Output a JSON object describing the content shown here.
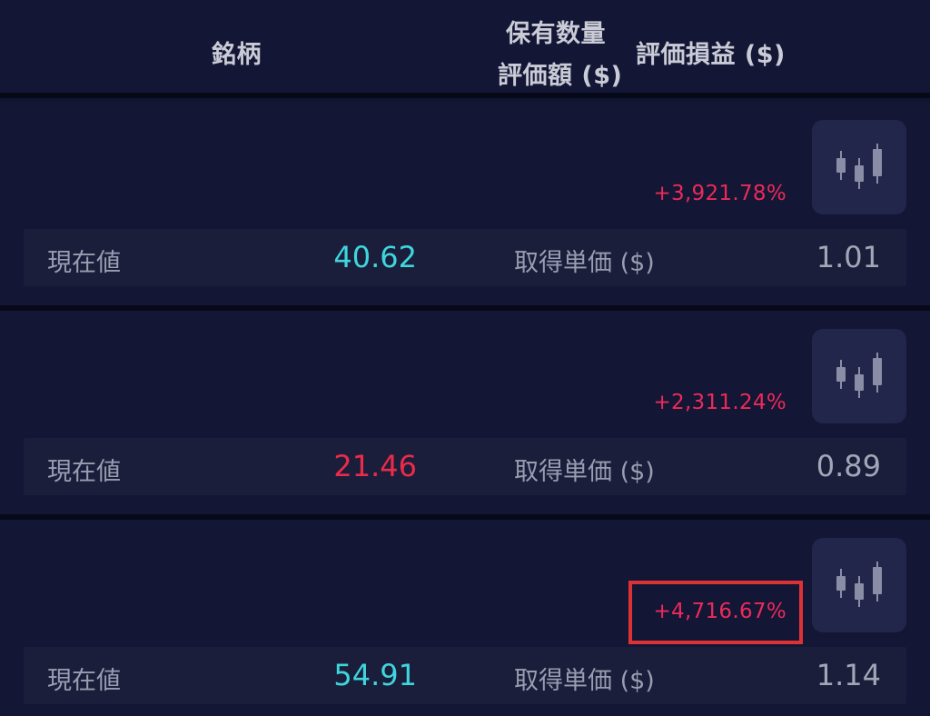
{
  "header": {
    "symbol_label": "銘柄",
    "quantity_label": "保有数量",
    "value_label": "評価額 ($)",
    "pnl_label": "評価損益 ($)"
  },
  "holdings": [
    {
      "pnl_percent": "+3,921.78%",
      "current_price_label": "現在値",
      "current_price": "40.62",
      "current_price_color": "#3ed6dc",
      "cost_label": "取得単価 ($)",
      "cost_price": "1.01",
      "chart_icon": "candlestick-chart-icon"
    },
    {
      "pnl_percent": "+2,311.24%",
      "current_price_label": "現在値",
      "current_price": "21.46",
      "current_price_color": "#ec2a4a",
      "cost_label": "取得単価 ($)",
      "cost_price": "0.89",
      "chart_icon": "candlestick-chart-icon"
    },
    {
      "pnl_percent": "+4,716.67%",
      "current_price_label": "現在値",
      "current_price": "54.91",
      "current_price_color": "#3ed6dc",
      "cost_label": "取得単価 ($)",
      "cost_price": "1.14",
      "chart_icon": "candlestick-chart-icon",
      "highlighted": true
    }
  ],
  "colors": {
    "background": "#121530",
    "gain_pink": "#ec2a5a",
    "highlight_red": "#dc3235"
  }
}
